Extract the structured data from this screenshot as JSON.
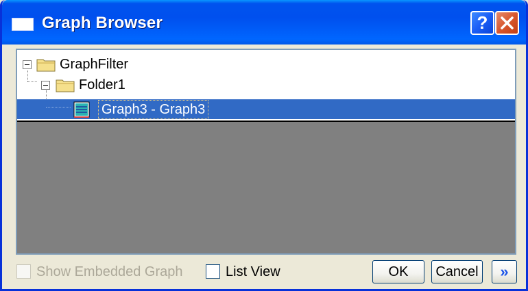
{
  "window": {
    "title": "Graph Browser",
    "help_glyph": "?",
    "title_icon": "window-icon",
    "accent": "#0055ea"
  },
  "tree": {
    "nodes": [
      {
        "label": "GraphFilter",
        "icon": "folder-icon",
        "expanded": true,
        "level": 0
      },
      {
        "label": "Folder1",
        "icon": "folder-icon",
        "expanded": true,
        "level": 1
      },
      {
        "label": "Graph3 - Graph3",
        "icon": "graph-icon",
        "selected": true,
        "level": 2
      }
    ],
    "selection_color": "#316ac5"
  },
  "footer": {
    "show_embedded_label": "Show Embedded Graph",
    "show_embedded_enabled": false,
    "show_embedded_checked": false,
    "list_view_label": "List View",
    "list_view_checked": false,
    "ok_label": "OK",
    "cancel_label": "Cancel",
    "more_glyph": "»"
  }
}
